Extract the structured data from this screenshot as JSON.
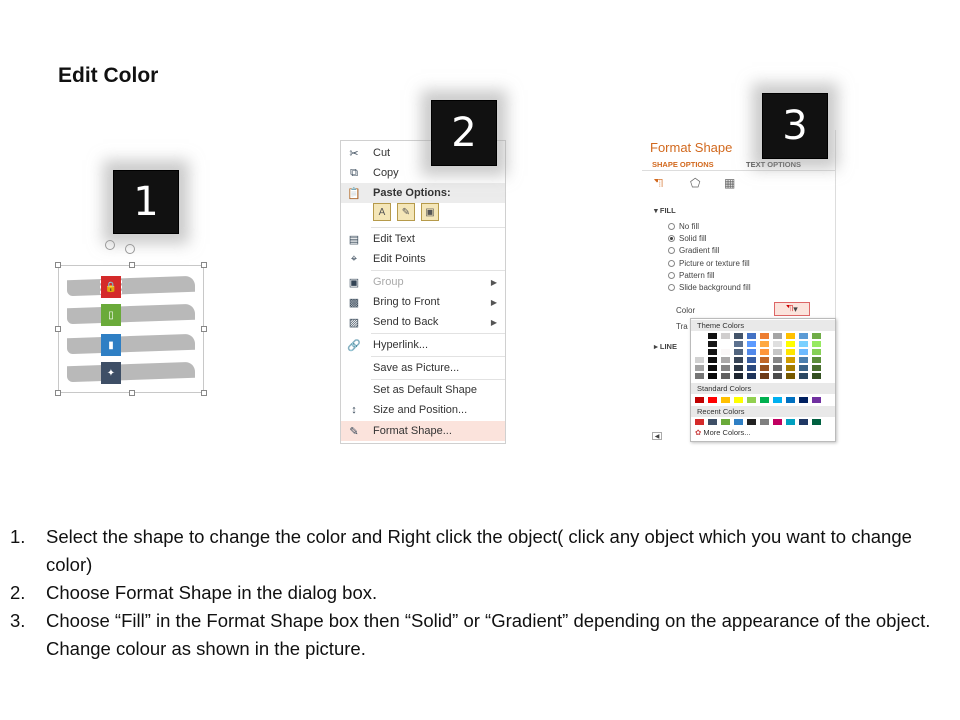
{
  "page": {
    "title": "Edit Color"
  },
  "badges": [
    "1",
    "2",
    "3"
  ],
  "context_menu": {
    "items": [
      {
        "label": "Cut",
        "icon": "scissors-icon"
      },
      {
        "label": "Copy",
        "icon": "copy-icon"
      },
      {
        "label": "Paste Options:",
        "icon": "paste-icon"
      },
      {
        "label": "Edit Text",
        "icon": "edit-text-icon"
      },
      {
        "label": "Edit Points",
        "icon": "edit-points-icon"
      },
      {
        "label": "Group",
        "icon": "group-icon"
      },
      {
        "label": "Bring to Front",
        "icon": "bring-front-icon"
      },
      {
        "label": "Send to Back",
        "icon": "send-back-icon"
      },
      {
        "label": "Hyperlink...",
        "icon": "hyperlink-icon"
      },
      {
        "label": "Save as Picture...",
        "icon": ""
      },
      {
        "label": "Set as Default Shape",
        "icon": ""
      },
      {
        "label": "Size and Position...",
        "icon": "size-icon"
      },
      {
        "label": "Format Shape...",
        "icon": "format-shape-icon"
      }
    ]
  },
  "format_shape": {
    "title": "Format Shape",
    "tab_shape": "SHAPE OPTIONS",
    "tab_text": "TEXT OPTIONS",
    "section_fill": "FILL",
    "options": [
      "No fill",
      "Solid fill",
      "Gradient fill",
      "Picture or texture fill",
      "Pattern fill",
      "Slide background fill"
    ],
    "color_label": "Color",
    "transparency_label": "Tra",
    "section_line": "LINE",
    "palette": {
      "theme": "Theme Colors",
      "standard": "Standard Colors",
      "recent": "Recent Colors",
      "more": "More Colors..."
    }
  },
  "steps": [
    {
      "num": "1.",
      "text": "Select the shape to change the color and Right click the object( click any object which you want to change color)"
    },
    {
      "num": "2.",
      "text": "Choose Format Shape in the dialog box."
    },
    {
      "num": "3.",
      "text": "Choose “Fill” in the Format Shape box then “Solid” or “Gradient” depending on the appearance of the object. Change colour as shown in the picture."
    }
  ],
  "colors": {
    "tag_red": "#d42a2a",
    "tag_green": "#6aaa3a",
    "tag_blue": "#2f7fc4",
    "tag_slate": "#3e4f66",
    "accent": "#d2691e"
  }
}
